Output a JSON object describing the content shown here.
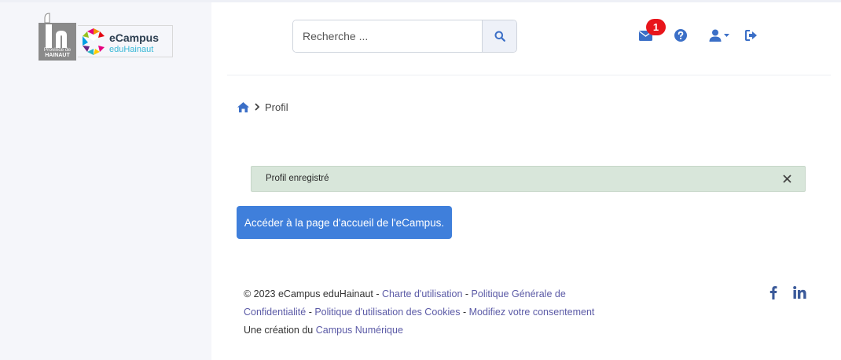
{
  "logo": {
    "province_line1": "Province de",
    "province_line2": "HAINAUT",
    "brand_name": "eCampus",
    "brand_sub": "eduHainaut"
  },
  "header": {
    "search_placeholder": "Recherche ...",
    "notifications_count": "1"
  },
  "breadcrumb": {
    "current": "Profil"
  },
  "alert": {
    "message": "Profil enregistré",
    "close_symbol": "×"
  },
  "primary_button": {
    "label": "Accéder à la page d'accueil de l'eCampus."
  },
  "footer": {
    "copyright": "© 2023 eCampus eduHainaut - ",
    "link_charter": "Charte d'utilisation",
    "sep1": " - ",
    "link_privacy": "Politique Générale de Confidentialité",
    "sep2": " - ",
    "link_cookies": "Politique d'utilisation des Cookies",
    "sep3": " - ",
    "link_consent": "Modifiez votre consentement",
    "creation_prefix": "Une création du ",
    "link_campus": "Campus Numérique"
  },
  "colors": {
    "accent": "#3f7fdb",
    "icon_blue": "#3b6fc7",
    "badge_red": "#e8151b",
    "alert_bg": "#d8e6da",
    "link": "#5b5aa6"
  },
  "icons": [
    "search-icon",
    "envelope-icon",
    "question-circle-icon",
    "user-icon",
    "sign-out-icon",
    "home-icon",
    "chevron-right-icon",
    "close-icon",
    "facebook-icon",
    "linkedin-icon"
  ]
}
